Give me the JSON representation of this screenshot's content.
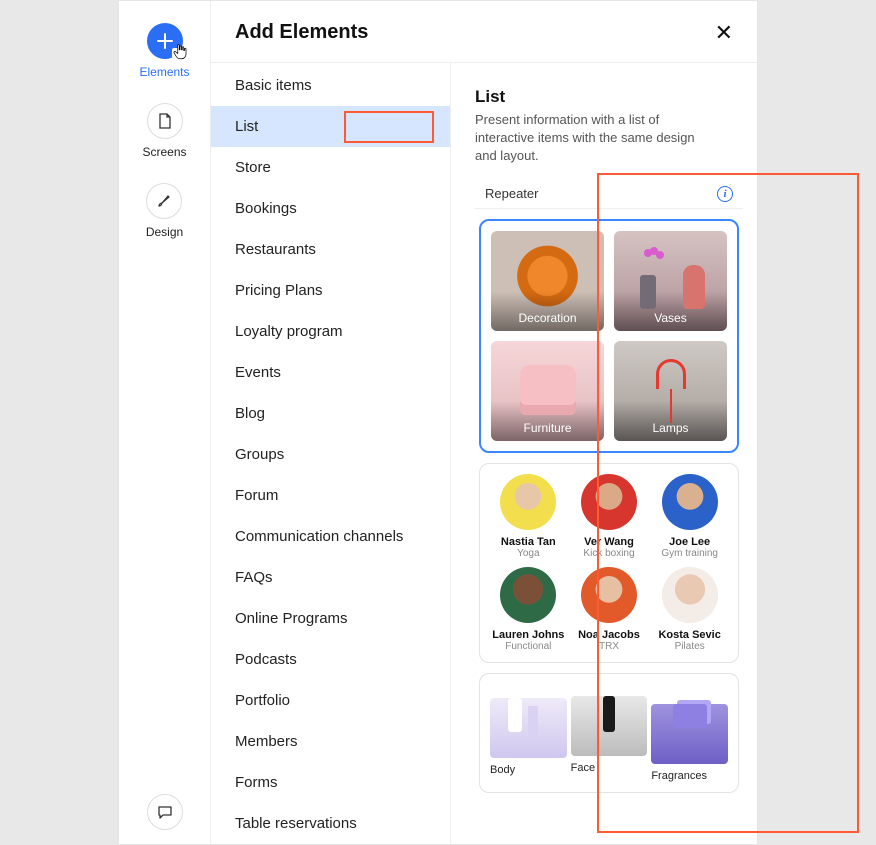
{
  "rail": {
    "elements": "Elements",
    "screens": "Screens",
    "design": "Design"
  },
  "panel": {
    "title": "Add Elements"
  },
  "categories": [
    "Basic items",
    "List",
    "Store",
    "Bookings",
    "Restaurants",
    "Pricing Plans",
    "Loyalty program",
    "Events",
    "Blog",
    "Groups",
    "Forum",
    "Communication channels",
    "FAQs",
    "Online Programs",
    "Podcasts",
    "Portfolio",
    "Members",
    "Forms",
    "Table reservations"
  ],
  "preview": {
    "title": "List",
    "desc": "Present information with a list of interactive items with the same design and layout.",
    "section": "Repeater",
    "tiles": {
      "decoration": "Decoration",
      "vases": "Vases",
      "furniture": "Furniture",
      "lamps": "Lamps"
    },
    "people": [
      {
        "name": "Nastia Tan",
        "sub": "Yoga"
      },
      {
        "name": "Ver Wang",
        "sub": "Kick boxing"
      },
      {
        "name": "Joe Lee",
        "sub": "Gym training"
      },
      {
        "name": "Lauren Johns",
        "sub": "Functional"
      },
      {
        "name": "Noa Jacobs",
        "sub": "TRX"
      },
      {
        "name": "Kosta Sevic",
        "sub": "Pilates"
      }
    ],
    "products": {
      "body": "Body",
      "face": "Face",
      "fragrances": "Fragrances"
    }
  }
}
